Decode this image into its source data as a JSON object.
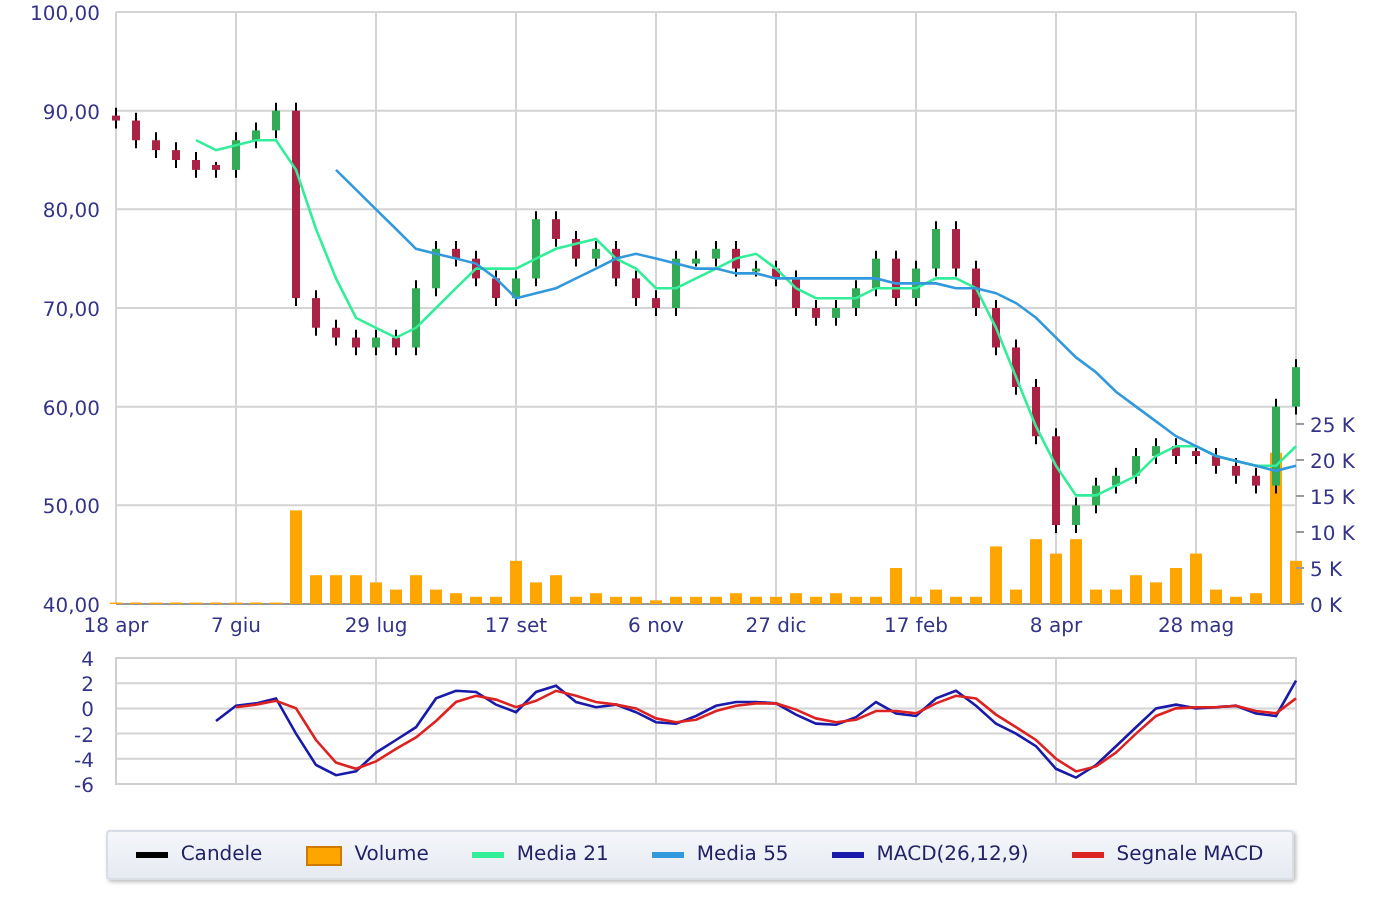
{
  "price_chart": {
    "chart_data": {
      "type": "candlestick",
      "grid": true,
      "categories": [
        "18 apr",
        null,
        null,
        null,
        null,
        null,
        "7 giu",
        null,
        null,
        null,
        null,
        null,
        null,
        "29 lug",
        null,
        null,
        null,
        null,
        null,
        null,
        "17 set",
        null,
        null,
        null,
        null,
        null,
        null,
        "6 nov",
        null,
        null,
        null,
        null,
        null,
        "27 dic",
        null,
        null,
        null,
        null,
        null,
        null,
        "17 feb",
        null,
        null,
        null,
        null,
        null,
        null,
        "8 apr",
        null,
        null,
        null,
        null,
        null,
        null,
        "28 mag",
        null,
        null,
        null,
        null,
        null
      ],
      "ylim": [
        40,
        100
      ],
      "y2lim": [
        0,
        82.2
      ],
      "yticks": [
        {
          "value": 40,
          "label": "40,00"
        },
        {
          "value": 50,
          "label": "50,00"
        },
        {
          "value": 60,
          "label": "60,00"
        },
        {
          "value": 70,
          "label": "70,00"
        },
        {
          "value": 80,
          "label": "80,00"
        },
        {
          "value": 90,
          "label": "90,00"
        },
        {
          "value": 100,
          "label": "100,00"
        }
      ],
      "y2ticks": [
        {
          "value": 0,
          "label": "0 K"
        },
        {
          "value": 5,
          "label": "5 K"
        },
        {
          "value": 10,
          "label": "10 K"
        },
        {
          "value": 15,
          "label": "15 K"
        },
        {
          "value": 20,
          "label": "20 K"
        },
        {
          "value": 25,
          "label": "25 K"
        }
      ],
      "series": [
        {
          "name": "Candele",
          "type": "candlestick",
          "ohlc": [
            [
              89.5,
              90.3,
              88.2,
              89
            ],
            [
              89,
              89.8,
              86.2,
              87
            ],
            [
              87,
              87.8,
              85.2,
              86
            ],
            [
              86,
              86.8,
              84.2,
              85
            ],
            [
              85,
              85.8,
              83.2,
              84
            ],
            [
              84.5,
              84.8,
              83.2,
              84
            ],
            [
              84,
              87.8,
              83.2,
              87
            ],
            [
              87,
              88.8,
              86.2,
              88
            ],
            [
              88,
              90.8,
              87.2,
              90
            ],
            [
              90,
              90.8,
              70.2,
              71
            ],
            [
              71,
              71.8,
              67.2,
              68
            ],
            [
              68,
              68.8,
              66.2,
              67
            ],
            [
              67,
              67.8,
              65.2,
              66
            ],
            [
              66,
              67.8,
              65.2,
              67
            ],
            [
              67,
              67.8,
              65.2,
              66
            ],
            [
              66,
              72.8,
              65.2,
              72
            ],
            [
              72,
              76.8,
              71.2,
              76
            ],
            [
              76,
              76.8,
              74.2,
              75
            ],
            [
              75,
              75.8,
              72.2,
              73
            ],
            [
              73,
              73.8,
              70.2,
              71
            ],
            [
              71,
              73.8,
              70.2,
              73
            ],
            [
              73,
              79.8,
              72.2,
              79
            ],
            [
              79,
              79.8,
              76.2,
              77
            ],
            [
              77,
              77.8,
              74.2,
              75
            ],
            [
              75,
              76.8,
              74.2,
              76
            ],
            [
              76,
              76.8,
              72.2,
              73
            ],
            [
              73,
              73.8,
              70.2,
              71
            ],
            [
              71,
              71.8,
              69.2,
              70
            ],
            [
              70,
              75.8,
              69.2,
              75
            ],
            [
              74.5,
              75.8,
              74.2,
              75
            ],
            [
              75,
              76.8,
              74.2,
              76
            ],
            [
              76,
              76.8,
              73.2,
              74
            ],
            [
              74,
              74.8,
              73.2,
              74
            ],
            [
              74,
              74.8,
              72.2,
              73
            ],
            [
              73,
              73.8,
              69.2,
              70
            ],
            [
              70,
              70.8,
              68.2,
              69
            ],
            [
              69,
              70.8,
              68.2,
              70
            ],
            [
              70,
              72.8,
              69.2,
              72
            ],
            [
              72,
              75.8,
              71.2,
              75
            ],
            [
              75,
              75.8,
              70.2,
              71
            ],
            [
              71,
              74.8,
              70.2,
              74
            ],
            [
              74,
              78.8,
              73.2,
              78
            ],
            [
              78,
              78.8,
              73.2,
              74
            ],
            [
              74,
              74.8,
              69.2,
              70
            ],
            [
              70,
              70.8,
              65.2,
              66
            ],
            [
              66,
              66.8,
              61.2,
              62
            ],
            [
              62,
              62.8,
              56.2,
              57
            ],
            [
              57,
              57.8,
              47.2,
              48
            ],
            [
              48,
              50.8,
              47.2,
              50
            ],
            [
              50,
              52.8,
              49.2,
              52
            ],
            [
              52,
              53.8,
              51.2,
              53
            ],
            [
              53,
              55.8,
              52.2,
              55
            ],
            [
              55,
              56.8,
              54.2,
              56
            ],
            [
              56,
              56.8,
              54.2,
              55
            ],
            [
              55.5,
              55.8,
              54.2,
              55
            ],
            [
              55,
              55.8,
              53.2,
              54
            ],
            [
              54,
              54.8,
              52.2,
              53
            ],
            [
              53,
              53.8,
              51.2,
              52
            ],
            [
              52,
              60.8,
              51.2,
              60
            ],
            [
              60,
              64.8,
              59.2,
              64
            ]
          ]
        },
        {
          "name": "Volume",
          "type": "bar",
          "axis": "y2",
          "color": "#ffa500",
          "values": [
            0.2,
            0.2,
            0.2,
            0.2,
            0.2,
            0.2,
            0.2,
            0.2,
            0.2,
            13,
            4,
            4,
            4,
            3,
            2,
            4,
            2,
            1.5,
            1,
            1,
            6,
            3,
            4,
            1,
            1.5,
            1,
            1,
            0.5,
            1,
            1,
            1,
            1.5,
            1,
            1,
            1.5,
            1,
            1.5,
            1,
            1,
            5,
            1,
            2,
            1,
            1,
            8,
            2,
            9,
            7,
            9,
            2,
            2,
            4,
            3,
            5,
            7,
            2,
            1,
            1.5,
            21,
            6
          ]
        },
        {
          "name": "Media 21",
          "type": "line",
          "color": "#33ee99",
          "values": [
            null,
            null,
            null,
            null,
            87,
            86,
            86.5,
            87,
            87,
            84,
            78,
            73,
            69,
            68,
            67,
            68,
            70,
            72,
            74,
            74,
            74,
            75,
            76,
            76.5,
            77,
            75,
            74,
            72,
            72,
            73,
            74,
            75,
            75.5,
            74,
            72,
            71,
            71,
            71,
            72,
            72,
            72,
            73,
            73,
            72,
            68,
            63,
            58,
            54,
            51,
            51,
            52,
            53,
            55,
            56,
            56,
            55,
            54.5,
            54,
            54,
            56
          ]
        },
        {
          "name": "Media 55",
          "type": "line",
          "color": "#3399dd",
          "values": [
            null,
            null,
            null,
            null,
            null,
            null,
            null,
            null,
            null,
            null,
            null,
            84,
            82,
            80,
            78,
            76,
            75.5,
            75,
            74.5,
            73,
            71,
            71.5,
            72,
            73,
            74,
            75,
            75.5,
            75,
            74.5,
            74,
            74,
            73.5,
            73.5,
            73,
            73,
            73,
            73,
            73,
            73,
            72.5,
            72.5,
            72.5,
            72,
            72,
            71.5,
            70.5,
            69,
            67,
            65,
            63.5,
            61.5,
            60,
            58.5,
            57,
            56,
            55,
            54.5,
            54,
            53.5,
            54
          ]
        }
      ]
    }
  },
  "macd_chart": {
    "chart_data": {
      "type": "line",
      "grid": true,
      "ylim": [
        -6,
        4
      ],
      "yticks": [
        {
          "value": -6,
          "label": "-6"
        },
        {
          "value": -4,
          "label": "-4"
        },
        {
          "value": -2,
          "label": "-2"
        },
        {
          "value": 0,
          "label": "0"
        },
        {
          "value": 2,
          "label": "2"
        },
        {
          "value": 4,
          "label": "4"
        }
      ],
      "series": [
        {
          "name": "MACD(26,12,9)",
          "color": "#1a1aaa",
          "values": [
            null,
            null,
            null,
            null,
            null,
            -1,
            0.2,
            0.4,
            0.8,
            -2,
            -4.5,
            -5.3,
            -5,
            -3.5,
            -2.5,
            -1.5,
            0.8,
            1.4,
            1.3,
            0.3,
            -0.3,
            1.3,
            1.8,
            0.5,
            0.1,
            0.3,
            -0.3,
            -1.1,
            -1.2,
            -0.6,
            0.2,
            0.5,
            0.5,
            0.4,
            -0.5,
            -1.2,
            -1.3,
            -0.7,
            0.5,
            -0.4,
            -0.6,
            0.8,
            1.4,
            0.2,
            -1.2,
            -2,
            -3,
            -4.8,
            -5.5,
            -4.5,
            -3,
            -1.5,
            0,
            0.3,
            0,
            0.1,
            0.2,
            -0.4,
            -0.6,
            2.2
          ]
        },
        {
          "name": "Segnale MACD",
          "color": "#dd2222",
          "values": [
            null,
            null,
            null,
            null,
            null,
            null,
            0.1,
            0.3,
            0.6,
            0,
            -2.5,
            -4.3,
            -4.8,
            -4.2,
            -3.2,
            -2.3,
            -1,
            0.5,
            1,
            0.7,
            0.1,
            0.6,
            1.4,
            1,
            0.5,
            0.3,
            0,
            -0.8,
            -1.1,
            -0.9,
            -0.2,
            0.2,
            0.4,
            0.4,
            -0.1,
            -0.8,
            -1.1,
            -0.9,
            -0.2,
            -0.2,
            -0.4,
            0.4,
            1,
            0.8,
            -0.5,
            -1.5,
            -2.5,
            -4,
            -5,
            -4.6,
            -3.5,
            -2,
            -0.6,
            0,
            0.1,
            0.1,
            0.2,
            -0.2,
            -0.4,
            0.8
          ]
        }
      ]
    }
  }
}
